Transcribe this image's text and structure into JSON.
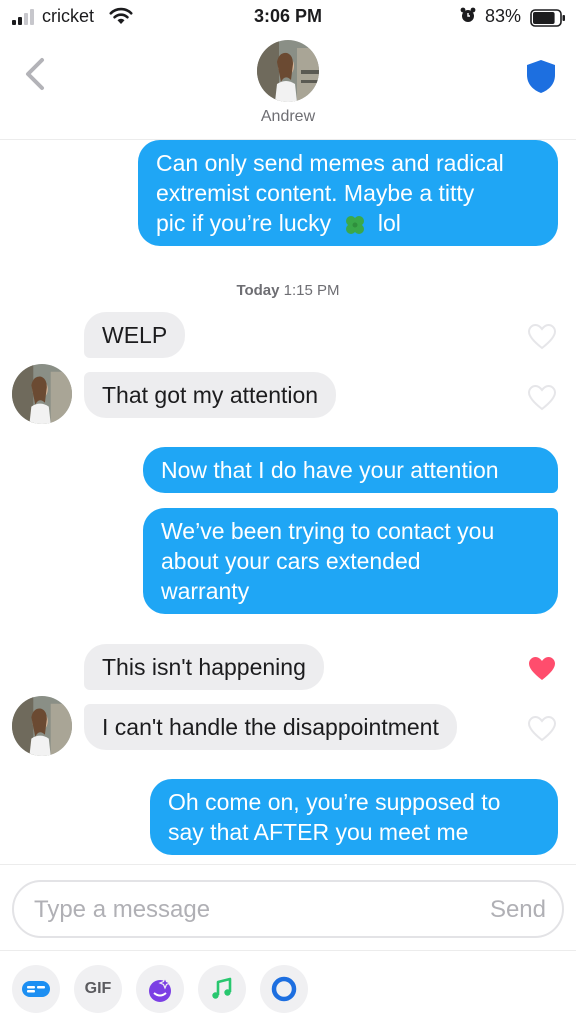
{
  "status_bar": {
    "carrier": "cricket",
    "time": "3:06 PM",
    "battery": "83%",
    "battery_level": 0.83
  },
  "header": {
    "contact_name": "Andrew",
    "back_icon": "chevron-left-icon",
    "safety_icon": "shield-icon"
  },
  "messages": [
    {
      "sender": "me",
      "lines": [
        "Can only send memes and radical",
        "extremist content. Maybe a titty",
        "pic if you’re lucky"
      ],
      "suffix": "lol",
      "emoji": "four-leaf-clover-icon"
    },
    {
      "sender": "them",
      "text": "WELP",
      "liked": false
    },
    {
      "sender": "them",
      "text": "That got my attention",
      "liked": false
    },
    {
      "sender": "me",
      "text": "Now that I do have your attention"
    },
    {
      "sender": "me",
      "lines": [
        "We’ve been trying to contact you",
        "about your cars extended",
        "warranty"
      ]
    },
    {
      "sender": "them",
      "text": "This isn't happening",
      "liked": true
    },
    {
      "sender": "them",
      "text": "I can't handle the disappointment",
      "liked": false
    },
    {
      "sender": "me",
      "lines": [
        "Oh come on, you’re supposed to",
        "say that AFTER you meet me"
      ]
    }
  ],
  "timestamp": {
    "day": "Today",
    "time": "1:15 PM"
  },
  "compose": {
    "placeholder": "Type a message",
    "send_label": "Send"
  },
  "toolbar": {
    "gif_label": "GIF"
  },
  "colors": {
    "outgoing_bubble": "#1fa6f5",
    "incoming_bubble": "#ededef",
    "liked_heart": "#ff4d6d",
    "shield": "#1d6fe0"
  }
}
